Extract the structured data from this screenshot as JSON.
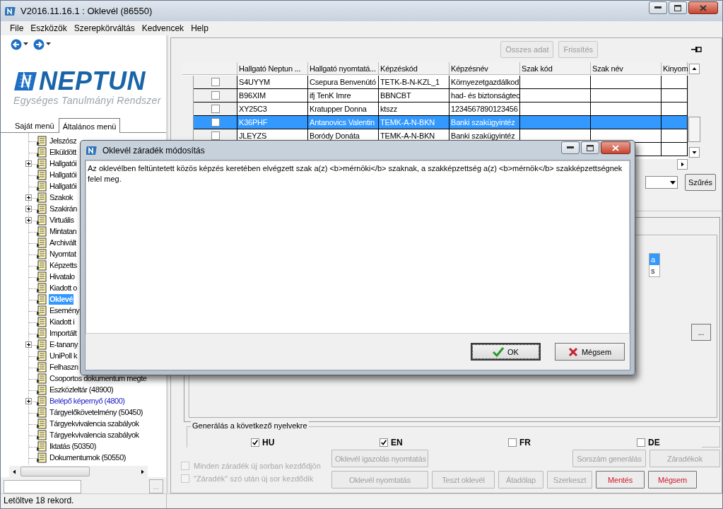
{
  "window": {
    "title": "V2016.11.16.1 : Oklevél (86550)"
  },
  "menu": [
    "File",
    "Eszközök",
    "Szerepkörváltás",
    "Kedvencek",
    "Help"
  ],
  "logo": {
    "name": "NEPTUN",
    "subtitle": "Egységes Tanulmányi Rendszer"
  },
  "sidebar": {
    "tabs": [
      {
        "label": "Saját menü",
        "selected": false
      },
      {
        "label": "Általános menü",
        "selected": true
      }
    ],
    "tree": [
      {
        "label": "Jelszósz",
        "expandable": false,
        "selected": false,
        "highlighted": false
      },
      {
        "label": "Elküldött",
        "expandable": false,
        "selected": false,
        "highlighted": false
      },
      {
        "label": "Hallgatói",
        "expandable": true,
        "selected": false,
        "highlighted": false
      },
      {
        "label": "Hallgatói",
        "expandable": false,
        "selected": false,
        "highlighted": false
      },
      {
        "label": "Hallgatói",
        "expandable": false,
        "selected": false,
        "highlighted": false
      },
      {
        "label": "Szakok",
        "expandable": true,
        "selected": false,
        "highlighted": false
      },
      {
        "label": "Szakirán",
        "expandable": true,
        "selected": false,
        "highlighted": false
      },
      {
        "label": "Virtuális",
        "expandable": true,
        "selected": false,
        "highlighted": false
      },
      {
        "label": "Mintatan",
        "expandable": false,
        "selected": false,
        "highlighted": false
      },
      {
        "label": "Archivált",
        "expandable": false,
        "selected": false,
        "highlighted": false
      },
      {
        "label": "Nyomtat",
        "expandable": false,
        "selected": false,
        "highlighted": false
      },
      {
        "label": "Képzetts",
        "expandable": false,
        "selected": false,
        "highlighted": false
      },
      {
        "label": "Hivatalo",
        "expandable": false,
        "selected": false,
        "highlighted": false
      },
      {
        "label": "Kiadott o",
        "expandable": false,
        "selected": false,
        "highlighted": false
      },
      {
        "label": "Oklevé",
        "expandable": false,
        "selected": true,
        "highlighted": false
      },
      {
        "label": "Esemény",
        "expandable": false,
        "selected": false,
        "highlighted": false
      },
      {
        "label": "Kiadott i",
        "expandable": false,
        "selected": false,
        "highlighted": false
      },
      {
        "label": "Importált",
        "expandable": false,
        "selected": false,
        "highlighted": false
      },
      {
        "label": "E-tanany",
        "expandable": true,
        "selected": false,
        "highlighted": false
      },
      {
        "label": "UniPoll k",
        "expandable": false,
        "selected": false,
        "highlighted": false
      },
      {
        "label": "Felhaszn",
        "expandable": false,
        "selected": false,
        "highlighted": false
      },
      {
        "label": "Csoportos dokumentum megte",
        "expandable": false,
        "selected": false,
        "highlighted": false
      },
      {
        "label": "Eszközleltár (48900)",
        "expandable": false,
        "selected": false,
        "highlighted": false
      },
      {
        "label": "Belépő képernyő (4800)",
        "expandable": true,
        "selected": false,
        "highlighted": true
      },
      {
        "label": "Tárgyelőkövetelmény (50450)",
        "expandable": false,
        "selected": false,
        "highlighted": false
      },
      {
        "label": "Tárgyekvivalencia szabályok",
        "expandable": false,
        "selected": false,
        "highlighted": false
      },
      {
        "label": "Tárgyekvivalencia szabályok",
        "expandable": false,
        "selected": false,
        "highlighted": false
      },
      {
        "label": "Iktatás (50350)",
        "expandable": false,
        "selected": false,
        "highlighted": false
      },
      {
        "label": "Dokumentumok (50550)",
        "expandable": false,
        "selected": false,
        "highlighted": false
      }
    ],
    "browse_button": "..."
  },
  "toolbar": [
    {
      "label": "Összes adat",
      "disabled": true
    },
    {
      "label": "Frissítés",
      "disabled": true
    }
  ],
  "table": {
    "columns": [
      "Hallgató Neptun ...",
      "Hallgató nyomtatá...",
      "Képzéskód",
      "Képzésnév",
      "Szak kód",
      "Szak név",
      "Kinyom"
    ],
    "rows": [
      {
        "checked": false,
        "selected": false,
        "cells": [
          "S4UYYM",
          "Csepura Benvenútó",
          "TETK-B-N-KZL_1",
          "Környezetgazdálkod"
        ]
      },
      {
        "checked": false,
        "selected": false,
        "cells": [
          "B96XIM",
          "ifj TenK Imre",
          "BBNCBT",
          "had- és biztonságtec"
        ]
      },
      {
        "checked": false,
        "selected": false,
        "cells": [
          "XY25C3",
          "Kratupper Donna",
          "ktszz",
          "1234567890123456"
        ]
      },
      {
        "checked": false,
        "selected": true,
        "cells": [
          "K36PHF",
          "Antanovics Valentin",
          "TEMK-A-N-BKN",
          "Banki szakügyintéz"
        ]
      },
      {
        "checked": false,
        "selected": false,
        "cells": [
          "JLEYZS",
          "Boródy Donáta",
          "TEMK-A-N-BKN",
          "Banki szakügyintéz"
        ]
      }
    ]
  },
  "filter_button": "Szűrés",
  "side_list": [
    {
      "text": "a",
      "selected": true
    },
    {
      "text": "s",
      "selected": false
    }
  ],
  "details_button": "...",
  "languages": {
    "title": "Generálás a következő nyelvekre",
    "options": [
      {
        "label": "HU",
        "checked": true
      },
      {
        "label": "EN",
        "checked": true
      },
      {
        "label": "FR",
        "checked": false
      },
      {
        "label": "DE",
        "checked": false
      }
    ]
  },
  "options": [
    {
      "label": "Minden záradék új sorban kezdődjön",
      "checked": false,
      "disabled": true
    },
    {
      "label": "\"Záradék\" szó után új sor kezdődik",
      "checked": false,
      "disabled": true
    }
  ],
  "action_rows": [
    {
      "buttons": [
        {
          "label": "Oklevél igazolás nyomtatás",
          "disabled": true,
          "accent": false
        },
        {
          "label": "Sorszám generálás",
          "disabled": true,
          "accent": false
        },
        {
          "label": "Záradékok",
          "disabled": true,
          "accent": false
        }
      ]
    },
    {
      "buttons": [
        {
          "label": "Oklevél nyomtatás",
          "disabled": true,
          "accent": false
        },
        {
          "label": "Teszt oklevél",
          "disabled": true,
          "accent": false
        },
        {
          "label": "Átadólap",
          "disabled": true,
          "accent": false
        },
        {
          "label": "Szerkeszt",
          "disabled": true,
          "accent": false
        },
        {
          "label": "Mentés",
          "disabled": false,
          "accent": true
        },
        {
          "label": "Mégsem",
          "disabled": false,
          "accent": true
        }
      ]
    }
  ],
  "status_bar": "Letöltve 18 rekord.",
  "dialog": {
    "title": "Oklevél záradék módosítás",
    "text": "Az oklevélben feltüntetett közös képzés keretében elvégzett szak a(z) <b>mérnöki</b> szaknak, a szakképzettség a(z) <b>mérnök</b> szakképzettségnek felel meg.",
    "buttons": [
      {
        "label": "OK",
        "kind": "ok",
        "focused": true
      },
      {
        "label": "Mégsem",
        "kind": "cancel",
        "focused": false
      }
    ]
  }
}
